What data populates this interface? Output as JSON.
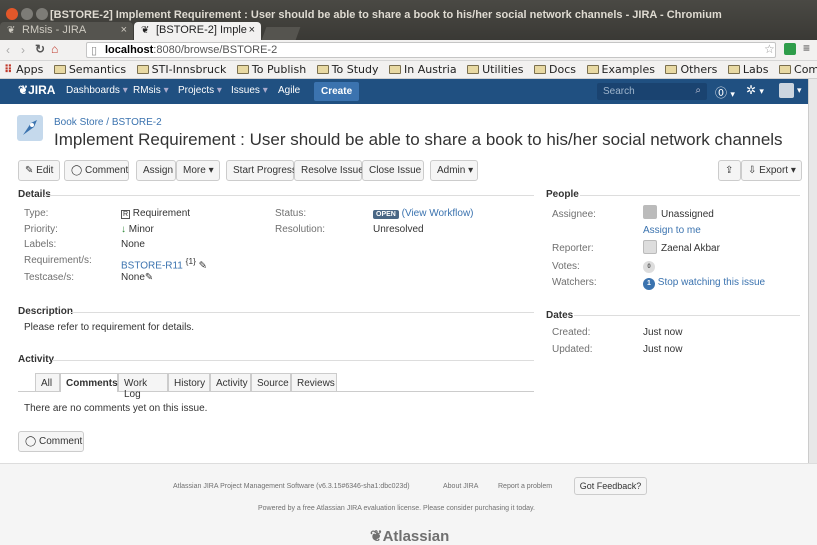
{
  "window": {
    "title": "[BSTORE-2] Implement Requirement : User should be able to share a book to his/her social network channels - JIRA - Chromium"
  },
  "tabs": [
    {
      "label": "RMsis - JIRA",
      "icon": "jira-icon"
    },
    {
      "label": "[BSTORE-2] Imple",
      "icon": "jira-icon"
    }
  ],
  "address": {
    "url_host": "localhost",
    "url_rest": ":8080/browse/BSTORE-2"
  },
  "bookmarks": [
    "Apps",
    "Semantics",
    "STI-Innsbruck",
    "To Publish",
    "To Study",
    "In Austria",
    "Utilities",
    "Docs",
    "Examples",
    "Others",
    "Labs",
    "Computing"
  ],
  "nav": {
    "logo": "JIRA",
    "items": [
      "Dashboards",
      "RMsis",
      "Projects",
      "Issues",
      "Agile"
    ],
    "create": "Create",
    "search_placeholder": "Search"
  },
  "issue": {
    "breadcrumb_project": "Book Store",
    "breadcrumb_key": "BSTORE-2",
    "summary": "Implement Requirement : User should be able to share a book to his/her social network channels"
  },
  "toolbar": {
    "edit": "Edit",
    "comment": "Comment",
    "assign": "Assign",
    "more": "More",
    "start": "Start Progress",
    "resolve": "Resolve Issue",
    "close": "Close Issue",
    "admin": "Admin",
    "export": "Export"
  },
  "details": {
    "heading": "Details",
    "type_label": "Type:",
    "type_value": "Requirement",
    "priority_label": "Priority:",
    "priority_value": "Minor",
    "labels_label": "Labels:",
    "labels_value": "None",
    "req_label": "Requirement/s:",
    "req_value": "BSTORE-R11",
    "req_sup": "{1}",
    "test_label": "Testcase/s:",
    "test_value": "None",
    "status_label": "Status:",
    "status_value": "OPEN",
    "status_link": "(View Workflow)",
    "resolution_label": "Resolution:",
    "resolution_value": "Unresolved"
  },
  "description": {
    "heading": "Description",
    "text": "Please refer to requirement for details."
  },
  "activity": {
    "heading": "Activity",
    "tabs": [
      "All",
      "Comments",
      "Work Log",
      "History",
      "Activity",
      "Source",
      "Reviews"
    ],
    "active": "Comments",
    "empty": "There are no comments yet on this issue.",
    "comment_button": "Comment"
  },
  "people": {
    "heading": "People",
    "assignee_label": "Assignee:",
    "assignee_value": "Unassigned",
    "assign_me": "Assign to me",
    "reporter_label": "Reporter:",
    "reporter_value": "Zaenal Akbar",
    "votes_label": "Votes:",
    "votes_count": "0",
    "watchers_label": "Watchers:",
    "watchers_count": "1",
    "watch_link": "Stop watching this issue"
  },
  "dates": {
    "heading": "Dates",
    "created_label": "Created:",
    "created_value": "Just now",
    "updated_label": "Updated:",
    "updated_value": "Just now"
  },
  "footer": {
    "line1_a": "Atlassian JIRA Project Management Software (v6.3.15#6346-sha1:dbc023d)",
    "line1_b": "About JIRA",
    "line1_c": "Report a problem",
    "feedback": "Got Feedback?",
    "line2": "Powered by a free Atlassian JIRA evaluation license. Please consider purchasing it today.",
    "logo": "Atlassian"
  }
}
